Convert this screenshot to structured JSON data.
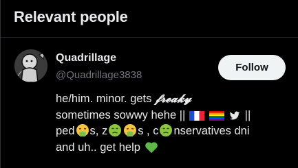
{
  "section": {
    "title": "Relevant people"
  },
  "person": {
    "name": "Quadrillage",
    "handle": "@Quadrillage3838",
    "follow_label": "Follow",
    "bio": {
      "line1_text": "he/him. minor. gets ",
      "line1_styled": "𝓯𝓻𝓮𝓪𝓴𝔂",
      "line2_text": "sometimes sowwy hehe || ",
      "line2_end": " ||",
      "line3_a": "ped",
      "line3_b": "s, z",
      "line3_c": "s , c",
      "line3_d": "nservatives dni",
      "line4_text": "and uh.. get help "
    },
    "bio_icons": [
      "france-flag-icon",
      "rainbow-flag-icon",
      "twitter-bird-icon",
      "vomiting-face-icon",
      "nauseated-face-icon",
      "green-heart-icon"
    ]
  },
  "colors": {
    "background": "#000000",
    "text": "#e7e9ea",
    "muted": "#71767b",
    "button_bg": "#eff3f4",
    "button_text": "#0f1419"
  }
}
